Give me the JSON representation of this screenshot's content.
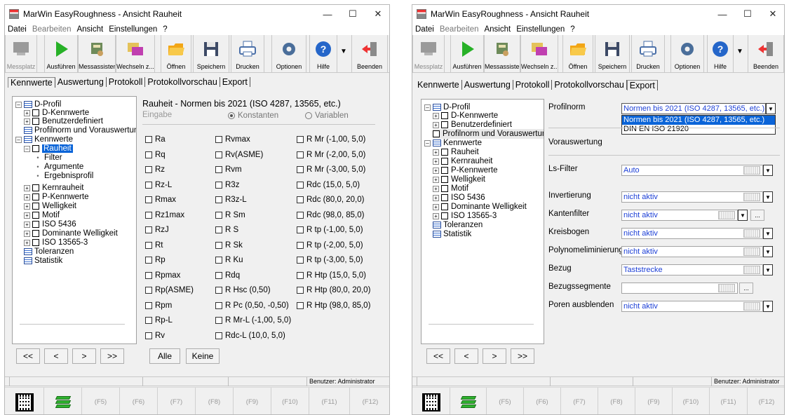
{
  "window_left": {
    "title": "MarWin EasyRoughness - Ansicht Rauheit",
    "menu": [
      "Datei",
      "Bearbeiten",
      "Ansicht",
      "Einstellungen",
      "?"
    ],
    "toolbar": [
      "Messplatz",
      "Ausführen",
      "Messassistent",
      "Wechseln z...",
      "Öffnen",
      "Speichern",
      "Drucken",
      "Optionen",
      "Hilfe",
      "Beenden"
    ],
    "tabs": [
      "Kennwerte",
      "Auswertung",
      "Protokoll",
      "Protokollvorschau",
      "Export"
    ],
    "tree": [
      "D-Profil",
      "D-Kennwerte",
      "Benutzerdefiniert",
      "Profilnorm und Vorauswertung",
      "Kennwerte",
      "Rauheit",
      "Filter",
      "Argumente",
      "Ergebnisprofil",
      "Kernrauheit",
      "P-Kennwerte",
      "Welligkeit",
      "Motif",
      "ISO 5436",
      "Dominante Welligkeit",
      "ISO 13565-3",
      "Toleranzen",
      "Statistik"
    ],
    "nav": [
      "<<",
      "<",
      ">",
      ">>"
    ],
    "header": "Rauheit   -   Normen bis 2021 (ISO 4287, 13565, etc.)",
    "eingabe": "Eingabe",
    "konstanten": "Konstanten",
    "variablen": "Variablen",
    "col1": [
      "Ra",
      "Rq",
      "Rz",
      "Rz-L",
      "Rmax",
      "Rz1max",
      "RzJ",
      "Rt",
      "Rp",
      "Rpmax",
      "Rp(ASME)",
      "Rpm",
      "Rp-L",
      "Rv"
    ],
    "col2": [
      "Rvmax",
      "Rv(ASME)",
      "Rvm",
      "R3z",
      "R3z-L",
      "R Sm",
      "R S",
      "R Sk",
      "R Ku",
      "Rdq",
      "R Hsc (0,50)",
      "R Pc (0,50, -0,50)",
      "R Mr-L (-1,00, 5,0)",
      "Rdc-L (10,0, 5,0)"
    ],
    "col3": [
      "R Mr (-1,00, 5,0)",
      "R Mr (-2,00, 5,0)",
      "R Mr (-3,00, 5,0)",
      "Rdc (15,0, 5,0)",
      "Rdc (80,0, 20,0)",
      "Rdc (98,0, 85,0)",
      "R tp (-1,00, 5,0)",
      "R tp (-2,00, 5,0)",
      "R tp (-3,00, 5,0)",
      "R Htp (15,0, 5,0)",
      "R Htp (80,0, 20,0)",
      "R Htp (98,0, 85,0)"
    ],
    "btn_alle": "Alle",
    "btn_keine": "Keine",
    "user": "Benutzer: Administrator",
    "fkeys": [
      "(F5)",
      "(F6)",
      "(F7)",
      "(F8)",
      "(F9)",
      "(F10)",
      "(F11)",
      "(F12)"
    ]
  },
  "window_right": {
    "title": "MarWin EasyRoughness - Ansicht Rauheit",
    "menu": [
      "Datei",
      "Bearbeiten",
      "Ansicht",
      "Einstellungen",
      "?"
    ],
    "toolbar": [
      "Messplatz",
      "Ausführen",
      "Messassistent",
      "Wechseln z...",
      "Öffnen",
      "Speichern",
      "Drucken",
      "Optionen",
      "Hilfe",
      "Beenden"
    ],
    "tabs": [
      "Kennwerte",
      "Auswertung",
      "Protokoll",
      "Protokollvorschau",
      "Export"
    ],
    "tree": [
      "D-Profil",
      "D-Kennwerte",
      "Benutzerdefiniert",
      "Profilnorm und Vorauswertung",
      "Kennwerte",
      "Rauheit",
      "Kernrauheit",
      "P-Kennwerte",
      "Welligkeit",
      "Motif",
      "ISO 5436",
      "Dominante Welligkeit",
      "ISO 13565-3",
      "Toleranzen",
      "Statistik"
    ],
    "nav": [
      "<<",
      "<",
      ">",
      ">>"
    ],
    "props": {
      "profilnorm_label": "Profilnorm",
      "profilnorm_value": "Normen bis 2021 (ISO 4287, 13565, etc.)",
      "profilnorm_options": [
        "Normen bis 2021 (ISO 4287, 13565, etc.)",
        "DIN EN ISO 21920"
      ],
      "vorauswertung": "Vorauswertung",
      "rows": [
        {
          "label": "Ls-Filter",
          "value": "Auto"
        },
        {
          "label": "Invertierung",
          "value": "nicht aktiv"
        },
        {
          "label": "Kantenfilter",
          "value": "nicht aktiv"
        },
        {
          "label": "Kreisbogen",
          "value": "nicht aktiv"
        },
        {
          "label": "Polynomeliminierung",
          "value": "nicht aktiv"
        },
        {
          "label": "Bezug",
          "value": "Taststrecke"
        },
        {
          "label": "Bezugssegmente",
          "value": ""
        },
        {
          "label": "Poren ausblenden",
          "value": "nicht aktiv"
        }
      ]
    },
    "user": "Benutzer: Administrator",
    "fkeys": [
      "(F5)",
      "(F6)",
      "(F7)",
      "(F8)",
      "(F9)",
      "(F10)",
      "(F11)",
      "(F12)"
    ]
  }
}
